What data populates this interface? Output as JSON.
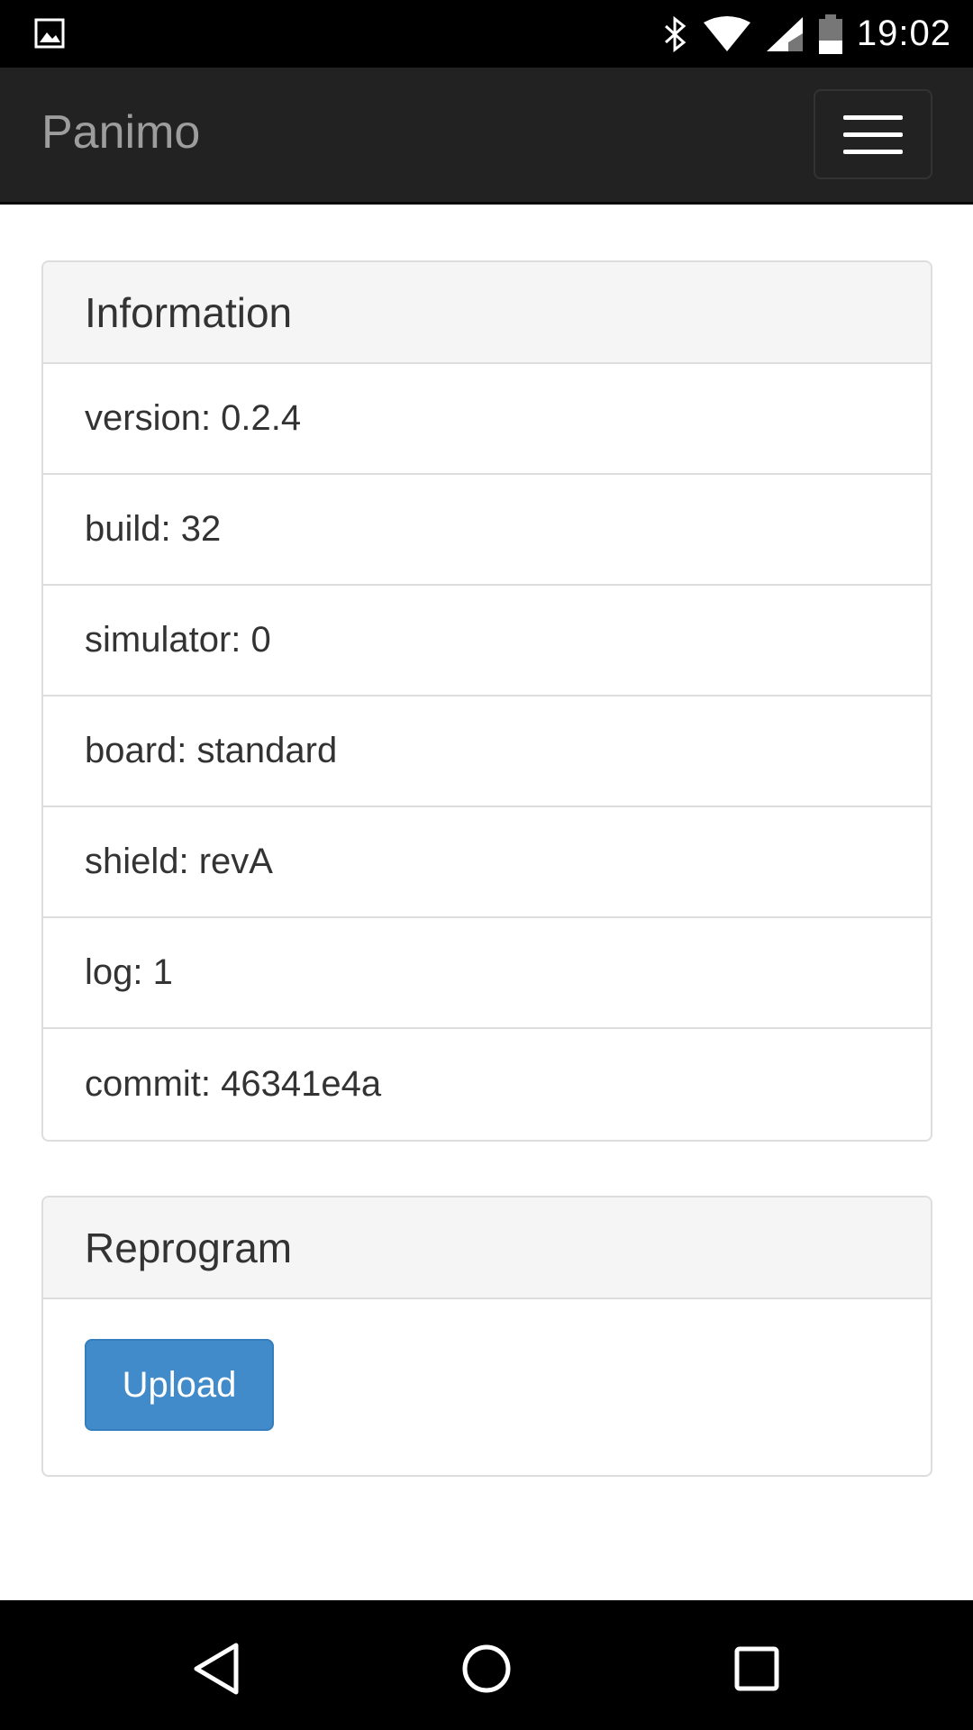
{
  "status_bar": {
    "time": "19:02",
    "icons": [
      "gallery-icon",
      "bluetooth-icon",
      "wifi-icon",
      "signal-icon",
      "battery-icon"
    ]
  },
  "navbar": {
    "brand": "Panimo",
    "toggle_icon": "hamburger-menu-icon"
  },
  "information_panel": {
    "title": "Information",
    "items": [
      "version: 0.2.4",
      "build: 32",
      "simulator: 0",
      "board: standard",
      "shield: revA",
      "log: 1",
      "commit: 46341e4a"
    ]
  },
  "reprogram_panel": {
    "title": "Reprogram",
    "upload_label": "Upload"
  },
  "nav_bar": {
    "icons": [
      "back-icon",
      "home-icon",
      "recents-icon"
    ]
  },
  "colors": {
    "navbar_bg": "#222222",
    "brand": "#9d9d9d",
    "primary_button": "#428bca",
    "panel_heading_bg": "#f5f5f5",
    "border": "#dddddd"
  }
}
